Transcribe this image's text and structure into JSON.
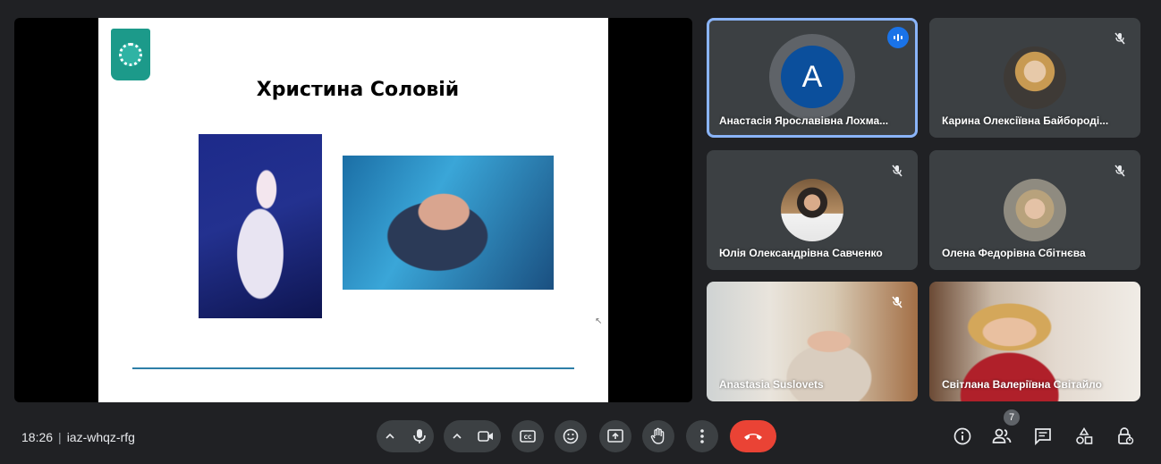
{
  "presentation": {
    "slide_title": "Христина Соловій"
  },
  "participants": [
    {
      "name": "Анастасія Ярославівна Лохма...",
      "avatar_letter": "A",
      "state": "speaking"
    },
    {
      "name": "Карина Олексіївна Байбороді...",
      "state": "muted"
    },
    {
      "name": "Юлія Олександрівна Савченко",
      "state": "muted"
    },
    {
      "name": "Олена Федорівна Сбітнєва",
      "state": "muted"
    },
    {
      "name": "Anastasia Suslovets",
      "state": "muted"
    },
    {
      "name": "Світлана Валеріївна Світайло",
      "state": "video"
    }
  ],
  "meeting": {
    "time": "18:26",
    "separator": "|",
    "code": "iaz-whqz-rfg",
    "people_count": "7"
  },
  "controls": {
    "mic": "microphone-icon",
    "camera": "camera-icon",
    "captions": "captions-icon",
    "reactions": "emoji-icon",
    "present": "present-screen-icon",
    "hand": "raise-hand-icon",
    "more": "more-options-icon",
    "end": "end-call-icon"
  },
  "colors": {
    "background": "#202124",
    "tile": "#3c4043",
    "active_outline": "#8ab4f8",
    "end_call": "#ea4335",
    "speaking": "#1a73e8"
  }
}
